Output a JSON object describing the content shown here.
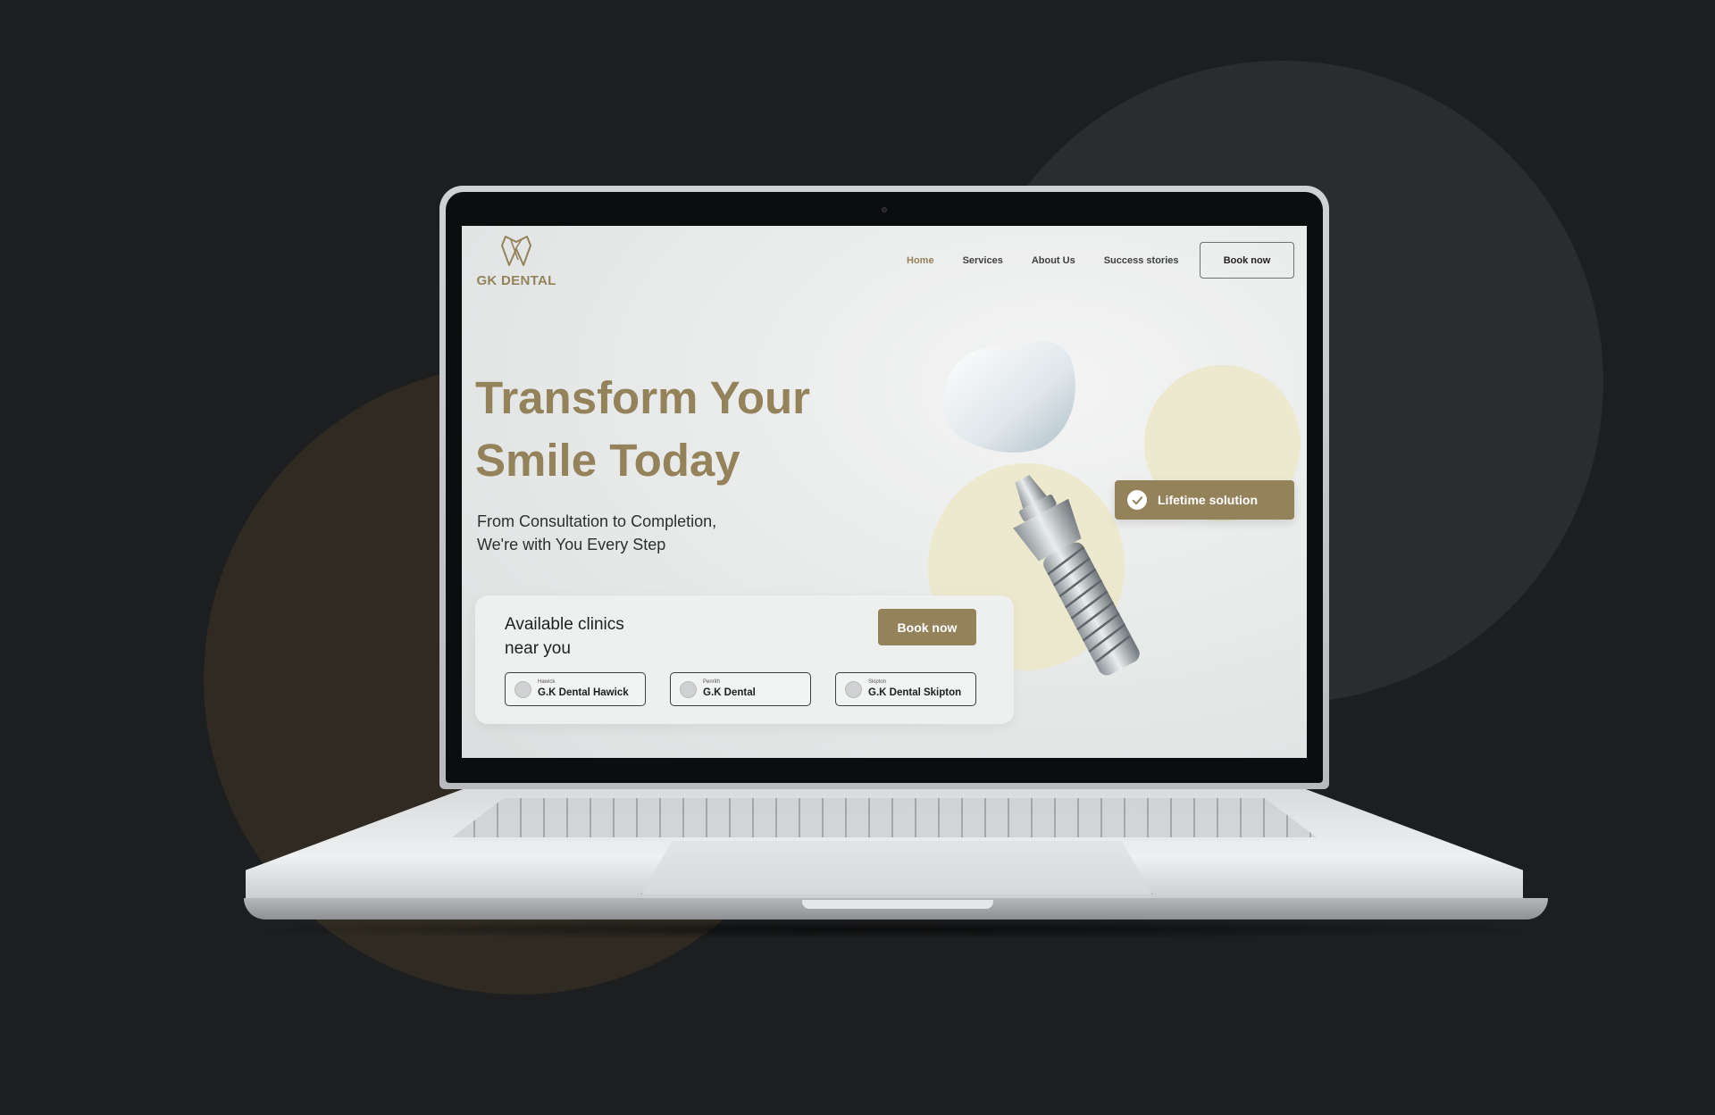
{
  "brand": {
    "name": "GK DENTAL",
    "accent_color": "#94825a"
  },
  "nav": {
    "items": [
      {
        "label": "Home",
        "active": true
      },
      {
        "label": "Services",
        "active": false
      },
      {
        "label": "About Us",
        "active": false
      },
      {
        "label": "Success stories",
        "active": false
      }
    ],
    "cta_label": "Book now"
  },
  "hero": {
    "title_line1": "Transform Your",
    "title_line2": "Smile Today",
    "subtitle_line1": "From Consultation to Completion,",
    "subtitle_line2": "We're with You Every Step"
  },
  "clinics": {
    "title_line1": "Available clinics",
    "title_line2": "near you",
    "book_label": "Book now",
    "items": [
      {
        "location": "Hawick",
        "name": "G.K Dental Hawick"
      },
      {
        "location": "Penrith",
        "name": "G.K Dental"
      },
      {
        "location": "Skipton",
        "name": "G.K Dental Skipton"
      }
    ]
  },
  "badge": {
    "label": "Lifetime solution",
    "icon": "check-icon"
  }
}
